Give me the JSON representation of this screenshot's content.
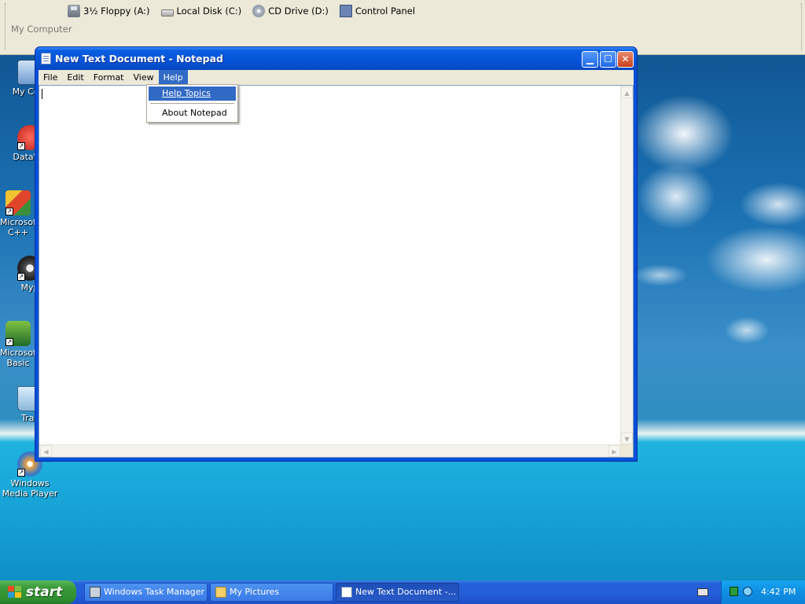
{
  "explorer": {
    "drives": [
      {
        "label": "3½ Floppy (A:)",
        "icon": "floppy-icon"
      },
      {
        "label": "Local Disk (C:)",
        "icon": "hard-disk-icon"
      },
      {
        "label": "CD Drive (D:)",
        "icon": "cd-drive-icon"
      },
      {
        "label": "Control Panel",
        "icon": "control-panel-icon"
      }
    ],
    "window_label": "My Computer"
  },
  "desktop_icons": [
    {
      "label": "My Com",
      "icon": "my-computer-icon"
    },
    {
      "label": "DataWa",
      "icon": "datawatch-icon"
    },
    {
      "label": "Microsoft C++",
      "icon": "visual-cpp-icon"
    },
    {
      "label": "Myp",
      "icon": "raccoon-icon"
    },
    {
      "label": "Microsoft Basic",
      "icon": "visual-basic-icon"
    },
    {
      "label": "Tras",
      "icon": "recycle-bin-icon"
    },
    {
      "label": "Windows Media Player",
      "icon": "media-player-icon"
    }
  ],
  "notepad": {
    "title": "New Text Document - Notepad",
    "menu": [
      "File",
      "Edit",
      "Format",
      "View",
      "Help"
    ],
    "active_menu": "Help",
    "help_menu": {
      "items": [
        "Help Topics",
        "About Notepad"
      ],
      "highlighted": "Help Topics"
    },
    "content": ""
  },
  "taskbar": {
    "start_label": "start",
    "tasks": [
      {
        "label": "Windows Task Manager",
        "active": false
      },
      {
        "label": "My Pictures",
        "active": false
      },
      {
        "label": "New Text Document -...",
        "active": true
      }
    ],
    "clock": "4:42 PM"
  }
}
